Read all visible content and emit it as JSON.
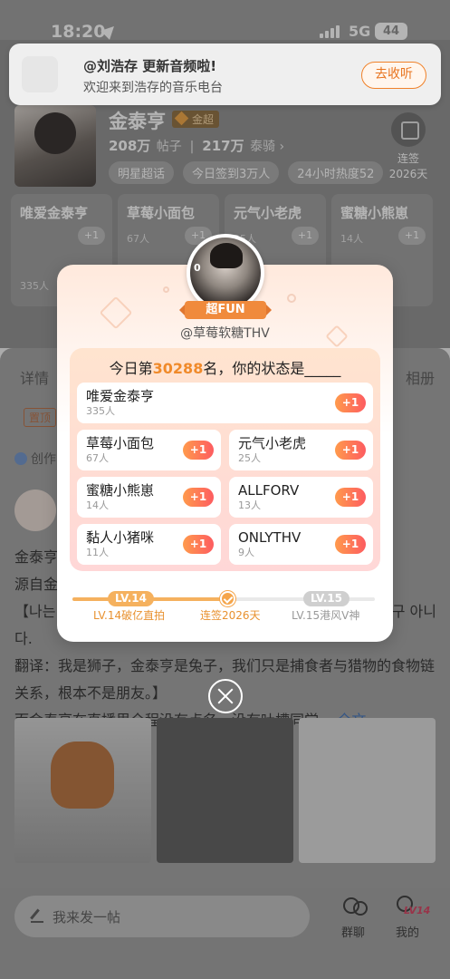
{
  "status_bar": {
    "time": "18:20",
    "network": "5G",
    "battery": "44"
  },
  "notification": {
    "title": "@刘浩存 更新音频啦!",
    "subtitle": "欢迎来到浩存的音乐电台",
    "button": "去收听"
  },
  "star": {
    "name": "金泰亨",
    "badge": "金超",
    "posts_count": "208万",
    "posts_label": "帖子",
    "fans_count": "217万",
    "fans_label": "泰骑",
    "fans_suffix": "›",
    "tags": [
      "明星超话",
      "今日签到3万人",
      "24小时热度52"
    ],
    "streak_label": "连签",
    "streak_days": "2026天"
  },
  "bg_fan_groups": [
    {
      "name": "唯爱金泰亨",
      "count": "335人",
      "plus": "+1"
    },
    {
      "name": "草莓小面包",
      "count": "67人",
      "plus": "+1"
    },
    {
      "name": "元气小老虎",
      "count": "25人",
      "plus": "+1"
    },
    {
      "name": "蜜糖小熊崽",
      "count": "14人",
      "plus": "+1"
    }
  ],
  "detail": {
    "tab_left": "详情",
    "tab_right": "相册",
    "pinned": "置顶",
    "creator": "创作"
  },
  "post": {
    "line1": "金泰亨",
    "line2": "源自金",
    "line3": "【나는 사",
    "line3_right": "구 아니",
    "line4": "다.",
    "translation": "翻译：我是狮子，金泰亨是兔子，我们只是捕食者与猎物的食物链关系，根本不是朋友。】",
    "last_line": "而金泰亨在直播里全程没有点名、没有吐槽同学...",
    "more": "全文"
  },
  "bottom_bar": {
    "post_placeholder": "我来发一帖",
    "group_chat": "群聊",
    "me": "我的",
    "me_level": "LV14"
  },
  "modal": {
    "avatar_number": "0",
    "fun_badge": "超FUN",
    "username": "@草莓软糖THV",
    "rank_prefix": "今日第",
    "rank_number": "30288",
    "rank_suffix": "名，你的状态是_____",
    "fan_groups": [
      {
        "name": "唯爱金泰亨",
        "count": "335人",
        "plus": "+1"
      },
      {
        "name": "草莓小面包",
        "count": "67人",
        "plus": "+1"
      },
      {
        "name": "元气小老虎",
        "count": "25人",
        "plus": "+1"
      },
      {
        "name": "蜜糖小熊崽",
        "count": "14人",
        "plus": "+1"
      },
      {
        "name": "ALLFORV",
        "count": "13人",
        "plus": "+1"
      },
      {
        "name": "黏人小猪咪",
        "count": "11人",
        "plus": "+1"
      },
      {
        "name": "ONLYTHV",
        "count": "9人",
        "plus": "+1"
      }
    ],
    "level_current": "LV.14",
    "level_next": "LV.15",
    "caption_current": "LV.14破亿直拍",
    "caption_mid": "连签2026天",
    "caption_next": "LV.15港风V神",
    "progress_fraction": 0.52
  }
}
